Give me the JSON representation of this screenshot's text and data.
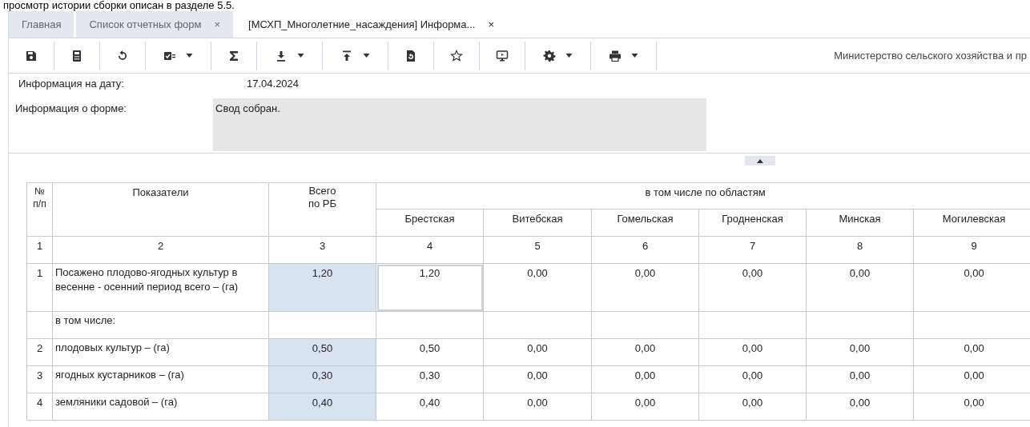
{
  "top_text": "просмотр истории сборки описан в разделе 5.5.",
  "tabs": [
    {
      "label": "Главная",
      "selected": false,
      "closable": false
    },
    {
      "label": "Список отчетных форм",
      "selected": false,
      "closable": true,
      "close": "×"
    },
    {
      "label": "[МСХП_Многолетние_насаждения] Информа...",
      "selected": true,
      "closable": true,
      "close": "×"
    }
  ],
  "toolbar": [
    {
      "has_menu": false
    },
    {
      "has_menu": false
    },
    {
      "has_menu": false
    },
    {
      "has_menu": true
    },
    {
      "has_menu": false
    },
    {
      "has_menu": true
    },
    {
      "has_menu": true
    },
    {
      "has_menu": false
    },
    {
      "has_menu": false
    },
    {
      "has_menu": false
    },
    {
      "has_menu": true
    },
    {
      "has_menu": true
    }
  ],
  "organization": "Министерство сельского хозяйства и пр",
  "info": {
    "date_label": "Информация на дату:",
    "date": "17.04.2024",
    "form_label": "Информация о форме:",
    "form_value": "Свод собран."
  },
  "table": {
    "head_no": "№ п/п",
    "head_indicator": "Показатели",
    "head_total": "Всего по РБ",
    "head_group": "в том числе по областям",
    "regions": [
      "Брестская",
      "Витебская",
      "Гомельская",
      "Гродненская",
      "Минская",
      "Могилевская"
    ],
    "column_numbers": [
      "1",
      "2",
      "3",
      "4",
      "5",
      "6",
      "7",
      "8",
      "9"
    ],
    "rows": [
      {
        "kind": "data",
        "no": "1",
        "indicator": "Посажено плодово-ягодных культур в весенне - осенний период всего – (га)",
        "total": "1,20",
        "cells": [
          {
            "text": "1,20",
            "selected": true
          },
          {
            "text": "0,00",
            "selected": false
          },
          {
            "text": "0,00",
            "selected": false
          },
          {
            "text": "0,00",
            "selected": false
          },
          {
            "text": "0,00",
            "selected": false
          },
          {
            "text": "0,00",
            "selected": false
          }
        ]
      },
      {
        "kind": "subheading",
        "indicator": "в том числе:"
      },
      {
        "kind": "data",
        "no": "2",
        "indicator": "плодовых культур – (га)",
        "total": "0,50",
        "cells": [
          {
            "text": "0,50",
            "selected": false
          },
          {
            "text": "0,00",
            "selected": false
          },
          {
            "text": "0,00",
            "selected": false
          },
          {
            "text": "0,00",
            "selected": false
          },
          {
            "text": "0,00",
            "selected": false
          },
          {
            "text": "0,00",
            "selected": false
          }
        ]
      },
      {
        "kind": "data",
        "no": "3",
        "indicator": "ягодных кустарников – (га)",
        "total": "0,30",
        "cells": [
          {
            "text": "0,30",
            "selected": false
          },
          {
            "text": "0,00",
            "selected": false
          },
          {
            "text": "0,00",
            "selected": false
          },
          {
            "text": "0,00",
            "selected": false
          },
          {
            "text": "0,00",
            "selected": false
          },
          {
            "text": "0,00",
            "selected": false
          }
        ]
      },
      {
        "kind": "data",
        "no": "4",
        "indicator": "земляники садовой – (га)",
        "total": "0,40",
        "cells": [
          {
            "text": "0,40",
            "selected": false
          },
          {
            "text": "0,00",
            "selected": false
          },
          {
            "text": "0,00",
            "selected": false
          },
          {
            "text": "0,00",
            "selected": false
          },
          {
            "text": "0,00",
            "selected": false
          },
          {
            "text": "0,00",
            "selected": false
          }
        ]
      }
    ]
  }
}
